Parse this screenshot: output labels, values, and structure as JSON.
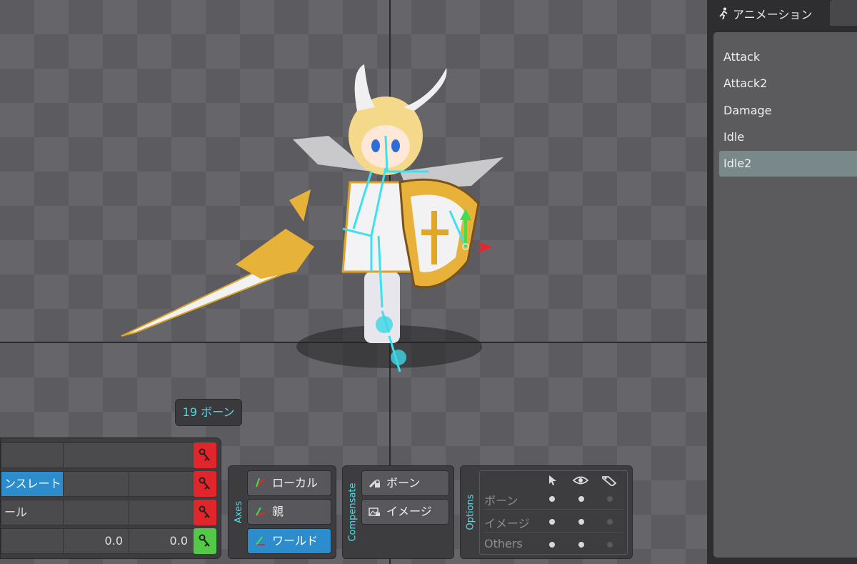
{
  "viewport": {
    "bone_count": "19 ボーン"
  },
  "transform": {
    "rows": [
      {
        "label": "",
        "values": [
          "",
          ""
        ],
        "key": "red"
      },
      {
        "label": "ンスレート",
        "values": [
          "",
          ""
        ],
        "key": "red"
      },
      {
        "label": "ール",
        "values": [
          "",
          ""
        ],
        "key": "red"
      },
      {
        "label": "",
        "values": [
          "0.0",
          "0.0"
        ],
        "key": "green"
      }
    ]
  },
  "axes": {
    "title": "Axes",
    "local": "ローカル",
    "parent": "親",
    "world": "ワールド",
    "active": "world"
  },
  "compensate": {
    "title": "Compensate",
    "bone": "ボーン",
    "image": "イメージ"
  },
  "options": {
    "title": "Options",
    "columns": [
      "select-icon",
      "eye-icon",
      "tag-icon"
    ],
    "rows": [
      {
        "name": "ボーン",
        "states": [
          "on",
          "on",
          "off"
        ]
      },
      {
        "name": "イメージ",
        "states": [
          "on",
          "on",
          "off"
        ]
      },
      {
        "name": "Others",
        "states": [
          "on",
          "on",
          "off"
        ]
      }
    ]
  },
  "animation_panel": {
    "tab_label": "アニメーション",
    "items": [
      "Attack",
      "Attack2",
      "Damage",
      "Idle",
      "Idle2"
    ],
    "selected": "Idle2"
  },
  "colors": {
    "accent_blue": "#2d8ccc",
    "bone_cyan": "#56d8e6",
    "key_red": "#e0262a",
    "key_green": "#54c847"
  }
}
